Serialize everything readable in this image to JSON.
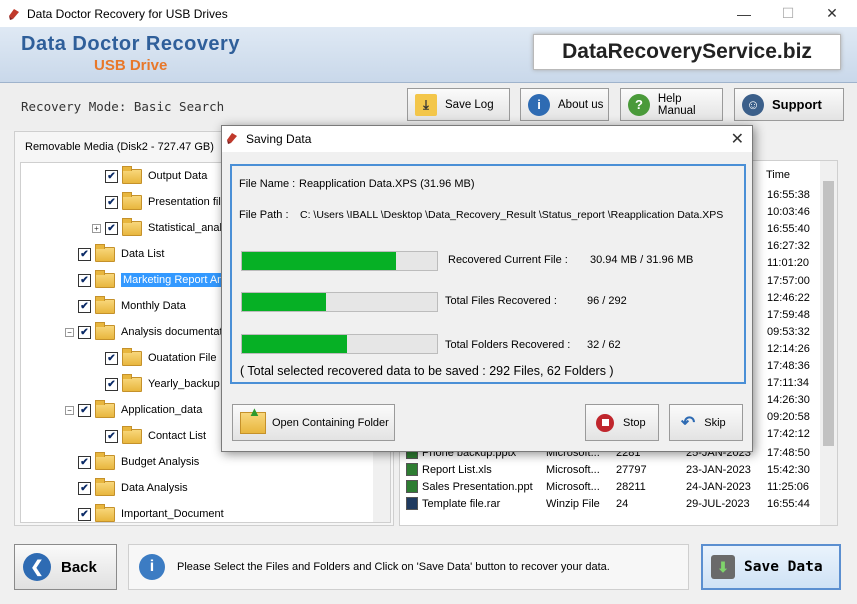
{
  "window": {
    "title": "Data Doctor Recovery for USB Drives",
    "minimize": "—",
    "maximize": "☐",
    "close": "✕"
  },
  "banner": {
    "brand": "Data Doctor Recovery",
    "product": "USB Drive",
    "site": "DataRecoveryService.biz"
  },
  "mode": "Recovery Mode: Basic Search",
  "toolbar": {
    "save_log": "Save Log",
    "about": "About us",
    "help": "Help Manual",
    "support": "Support"
  },
  "left": {
    "media": "Removable Media (Disk2 - 727.47 GB)",
    "tree": [
      {
        "label": "Output Data",
        "checked": true,
        "level": 2
      },
      {
        "label": "Presentation file",
        "checked": true,
        "level": 2
      },
      {
        "label": "Statistical_analysis",
        "checked": true,
        "level": 2,
        "expander": "+"
      },
      {
        "label": "Data List",
        "checked": true,
        "level": 1
      },
      {
        "label": "Marketing Report Analysis",
        "checked": true,
        "level": 1,
        "selected": true
      },
      {
        "label": "Monthly Data",
        "checked": true,
        "level": 1
      },
      {
        "label": "Analysis documentation",
        "checked": true,
        "level": 1,
        "expander": "−"
      },
      {
        "label": "Ouatation File",
        "checked": true,
        "level": 2
      },
      {
        "label": "Yearly_backup",
        "checked": true,
        "level": 2
      },
      {
        "label": "Application_data",
        "checked": true,
        "level": 1,
        "expander": "−"
      },
      {
        "label": "Contact List",
        "checked": true,
        "level": 2
      },
      {
        "label": "Budget Analysis",
        "checked": true,
        "level": 1
      },
      {
        "label": "Data Analysis",
        "checked": true,
        "level": 1
      },
      {
        "label": "Important_Document",
        "checked": true,
        "level": 1
      }
    ]
  },
  "right": {
    "time_header": "Time",
    "times": [
      "16:55:38",
      "10:03:46",
      "16:55:40",
      "16:27:32",
      "11:01:20",
      "17:57:00",
      "12:46:22",
      "17:59:48",
      "09:53:32",
      "12:14:26",
      "17:48:36",
      "17:11:34",
      "14:26:30",
      "09:20:58",
      "17:42:12",
      "17:48:50"
    ],
    "rows": [
      {
        "name": "Phone backup.pptx",
        "type": "Microsoft...",
        "size": "2281",
        "date": "25-JAN-2023",
        "time": "17:48:50"
      },
      {
        "name": "Report List.xls",
        "type": "Microsoft...",
        "size": "27797",
        "date": "23-JAN-2023",
        "time": "15:42:30"
      },
      {
        "name": "Sales Presentation.ppt",
        "type": "Microsoft...",
        "size": "28211",
        "date": "24-JAN-2023",
        "time": "11:25:06"
      },
      {
        "name": "Template file.rar",
        "type": "Winzip File",
        "size": "24",
        "date": "29-JUL-2023",
        "time": "16:55:44"
      }
    ]
  },
  "dialog": {
    "title": "Saving Data",
    "file_name_label": "File Name :",
    "file_name": "Reapplication Data.XPS (31.96 MB)",
    "file_path_label": "File Path :",
    "file_path": "C: \\Users \\IBALL \\Desktop \\Data_Recovery_Result \\Status_report \\Reapplication Data.XPS",
    "recovered_current_label": "Recovered Current File :",
    "recovered_current": "30.94 MB /  31.96 MB",
    "recovered_current_progress": 0.79,
    "files_label": "Total Files Recovered :",
    "files": "96 / 292",
    "files_progress": 0.43,
    "folders_label": "Total Folders Recovered :",
    "folders": "32 / 62",
    "folders_progress": 0.54,
    "summary": "( Total selected recovered data to be saved : 292 Files, 62 Folders )",
    "open_folder": "Open Containing Folder",
    "stop": "Stop",
    "skip": "Skip"
  },
  "status": {
    "back": "Back",
    "info": "Please Select the Files and Folders and Click on 'Save Data' button to recover your data.",
    "save": "Save Data"
  },
  "colors": {
    "progress": "#06b025",
    "accent": "#4a8fd6",
    "brand": "#2f5f9a",
    "product": "#e8782a"
  }
}
